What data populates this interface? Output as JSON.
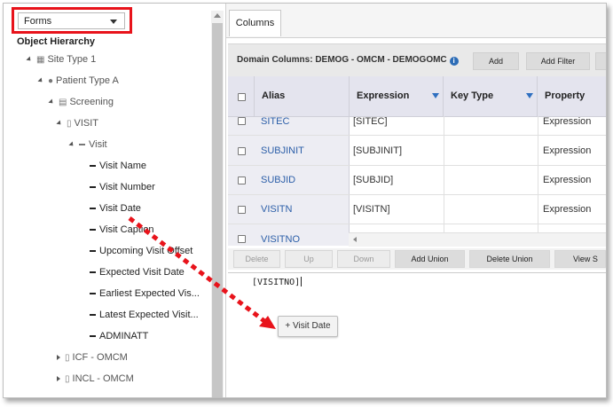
{
  "forms_dropdown": {
    "selected": "Forms"
  },
  "tree": {
    "title": "Object Hierarchy",
    "nodes": {
      "site": "Site Type 1",
      "patient": "Patient Type A",
      "screening": "Screening",
      "visit_form": "VISIT",
      "visit_section": "Visit",
      "items": [
        "Visit Name",
        "Visit Number",
        "Visit Date",
        "Visit Caption",
        "Upcoming Visit Offset",
        "Expected Visit Date",
        "Earliest Expected Vis...",
        "Latest Expected Visit...",
        "ADMINATT"
      ],
      "icf": "ICF - OMCM",
      "incl": "INCL - OMCM"
    }
  },
  "tabs": {
    "columns": "Columns"
  },
  "domain": {
    "title": "Domain Columns: DEMOG - OMCM - DEMOGOMC",
    "info_icon": "info-icon",
    "add_label": "Add",
    "add_filter_label": "Add Filter"
  },
  "grid": {
    "headers": {
      "alias": "Alias",
      "expression": "Expression",
      "key_type": "Key Type",
      "property": "Property"
    },
    "rows": [
      {
        "alias": "SITEC",
        "expression": "[SITEC]",
        "property": "Expression"
      },
      {
        "alias": "SUBJINIT",
        "expression": "[SUBJINIT]",
        "property": "Expression"
      },
      {
        "alias": "SUBJID",
        "expression": "[SUBJID]",
        "property": "Expression"
      },
      {
        "alias": "VISITN",
        "expression": "[VISITN]",
        "property": "Expression"
      },
      {
        "alias": "VISITNO",
        "expression": "",
        "property": ""
      }
    ]
  },
  "toolbar": {
    "delete": "Delete",
    "up": "Up",
    "down": "Down",
    "add_union": "Add Union",
    "delete_union": "Delete Union",
    "view": "View S"
  },
  "editor": {
    "expression": "[VISITNO]"
  },
  "drag_chip": {
    "icon": "plus-icon",
    "label": "Visit Date"
  },
  "colors": {
    "highlight": "#e8131b",
    "link": "#2b5ea8",
    "filter": "#2f6fc0"
  }
}
